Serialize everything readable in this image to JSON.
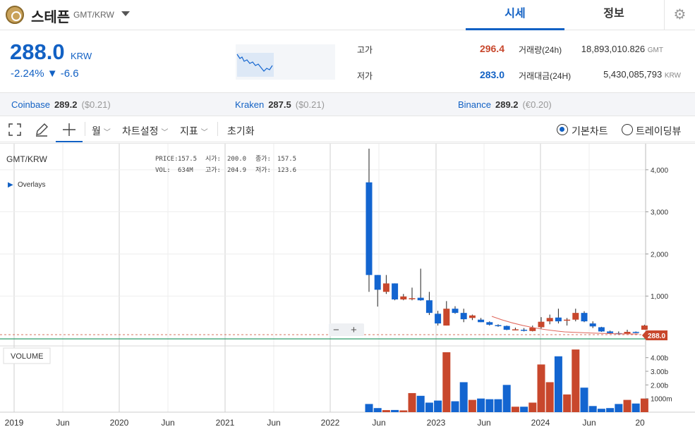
{
  "header": {
    "coin_name": "스테픈",
    "coin_pair": "GMT/KRW",
    "tabs": [
      {
        "label": "시세",
        "active": true
      },
      {
        "label": "정보",
        "active": false
      }
    ]
  },
  "ticker": {
    "price": "288.0",
    "unit": "KRW",
    "change_rate": "-2.24%",
    "change_amount": "▼ -6.6",
    "high_label": "고가",
    "high_value": "296.4",
    "low_label": "저가",
    "low_value": "283.0",
    "volume_label": "거래량(24h)",
    "volume_value": "18,893,010.826",
    "volume_unit": "GMT",
    "amount_label": "거래대금(24H)",
    "amount_value": "5,430,085,793",
    "amount_unit": "KRW"
  },
  "exchanges": [
    {
      "name": "Coinbase",
      "price": "289.2",
      "diff": "($0.21)"
    },
    {
      "name": "Kraken",
      "price": "287.5",
      "diff": "($0.21)"
    },
    {
      "name": "Binance",
      "price": "289.2",
      "diff": "(€0.20)"
    }
  ],
  "toolbar": {
    "interval": "월",
    "chart_settings": "차트설정",
    "indicators": "지표",
    "reset": "초기화",
    "mode_basic": "기본차트",
    "mode_tradingview": "트레이딩뷰"
  },
  "chart_data": {
    "type": "candlestick",
    "title": "GMT/KRW",
    "overlays_label": "Overlays",
    "volume_label": "VOLUME",
    "info": {
      "price_label": "PRICE:",
      "price": "157.5",
      "open_label": "시가:",
      "open": "200.0",
      "close_label": "종가:",
      "close": "157.5",
      "vol_label": "VOL:",
      "vol": "634M",
      "high_label": "고가:",
      "high": "204.9",
      "low_label": "저가:",
      "low": "123.6"
    },
    "current_price_tag": "288.0",
    "y_ticks": [
      "4,000",
      "3,000",
      "2,000",
      "1,000"
    ],
    "volume_ticks": [
      "4.00b",
      "3.00b",
      "2.00b",
      "1000m"
    ],
    "x_ticks": [
      "2019",
      "Jun",
      "2020",
      "Jun",
      "2021",
      "Jun",
      "2022",
      "Jun",
      "2023",
      "Jun",
      "2024",
      "Jun",
      "20"
    ],
    "ylim": [
      0,
      4500
    ],
    "volume_max": 4500,
    "candles": [
      {
        "o": 3700,
        "h": 4500,
        "l": 1100,
        "c": 1500,
        "v": 600
      },
      {
        "o": 1500,
        "h": 1500,
        "l": 750,
        "c": 1150,
        "v": 300
      },
      {
        "o": 1100,
        "h": 1500,
        "l": 1050,
        "c": 1300,
        "v": 150
      },
      {
        "o": 1300,
        "h": 1300,
        "l": 900,
        "c": 920,
        "v": 160
      },
      {
        "o": 920,
        "h": 1050,
        "l": 900,
        "c": 990,
        "v": 130
      },
      {
        "o": 950,
        "h": 1200,
        "l": 900,
        "c": 950,
        "v": 1400
      },
      {
        "o": 960,
        "h": 1650,
        "l": 890,
        "c": 900,
        "v": 1200
      },
      {
        "o": 900,
        "h": 1100,
        "l": 550,
        "c": 600,
        "v": 700
      },
      {
        "o": 580,
        "h": 650,
        "l": 300,
        "c": 350,
        "v": 850
      },
      {
        "o": 300,
        "h": 880,
        "l": 300,
        "c": 700,
        "v": 4400
      },
      {
        "o": 700,
        "h": 760,
        "l": 580,
        "c": 600,
        "v": 800
      },
      {
        "o": 600,
        "h": 700,
        "l": 380,
        "c": 450,
        "v": 2200
      },
      {
        "o": 480,
        "h": 560,
        "l": 430,
        "c": 540,
        "v": 900
      },
      {
        "o": 440,
        "h": 480,
        "l": 380,
        "c": 380,
        "v": 1000
      },
      {
        "o": 380,
        "h": 400,
        "l": 300,
        "c": 320,
        "v": 950
      },
      {
        "o": 310,
        "h": 330,
        "l": 270,
        "c": 290,
        "v": 950
      },
      {
        "o": 290,
        "h": 300,
        "l": 190,
        "c": 200,
        "v": 2000
      },
      {
        "o": 200,
        "h": 250,
        "l": 190,
        "c": 210,
        "v": 400
      },
      {
        "o": 200,
        "h": 240,
        "l": 160,
        "c": 180,
        "v": 400
      },
      {
        "o": 170,
        "h": 300,
        "l": 160,
        "c": 250,
        "v": 700
      },
      {
        "o": 260,
        "h": 500,
        "l": 230,
        "c": 390,
        "v": 3500
      },
      {
        "o": 400,
        "h": 560,
        "l": 330,
        "c": 480,
        "v": 2200
      },
      {
        "o": 490,
        "h": 700,
        "l": 350,
        "c": 400,
        "v": 4100
      },
      {
        "o": 420,
        "h": 480,
        "l": 300,
        "c": 440,
        "v": 1300
      },
      {
        "o": 440,
        "h": 700,
        "l": 400,
        "c": 600,
        "v": 4600
      },
      {
        "o": 600,
        "h": 640,
        "l": 380,
        "c": 400,
        "v": 1800
      },
      {
        "o": 350,
        "h": 400,
        "l": 240,
        "c": 280,
        "v": 450
      },
      {
        "o": 260,
        "h": 270,
        "l": 150,
        "c": 160,
        "v": 250
      },
      {
        "o": 160,
        "h": 180,
        "l": 110,
        "c": 120,
        "v": 300
      },
      {
        "o": 120,
        "h": 160,
        "l": 95,
        "c": 110,
        "v": 600
      },
      {
        "o": 110,
        "h": 200,
        "l": 100,
        "c": 150,
        "v": 900
      },
      {
        "o": 150,
        "h": 160,
        "l": 120,
        "c": 125,
        "v": 634
      },
      {
        "o": 200,
        "h": 320,
        "l": 200,
        "c": 300,
        "v": 1000
      }
    ]
  },
  "colors": {
    "accent": "#1261c4",
    "up": "#c8472c",
    "down": "#1365d0"
  }
}
